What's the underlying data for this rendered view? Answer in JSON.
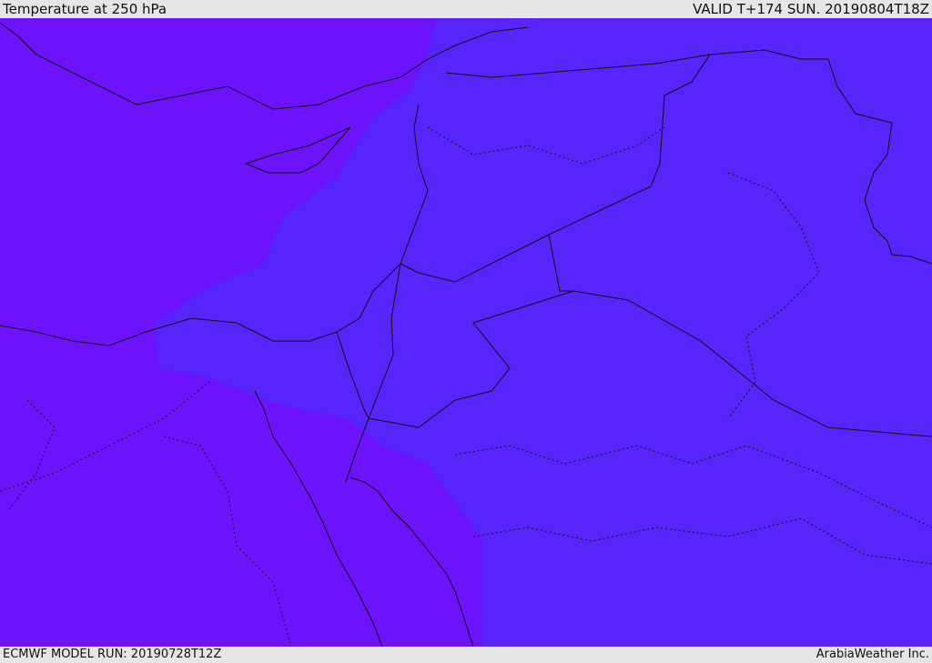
{
  "header": {
    "title": "Temperature at 250 hPa",
    "valid_time": "VALID T+174 SUN. 20190804T18Z"
  },
  "footer": {
    "model_run": "ECMWF MODEL RUN: 20190728T12Z",
    "credit": "ArabiaWeather Inc."
  },
  "map": {
    "variable": "temperature",
    "level": "250 hPa",
    "colors": {
      "cold_zone": "#6c13fb",
      "warm_zone": "#5724fa",
      "border": "#111111"
    }
  }
}
